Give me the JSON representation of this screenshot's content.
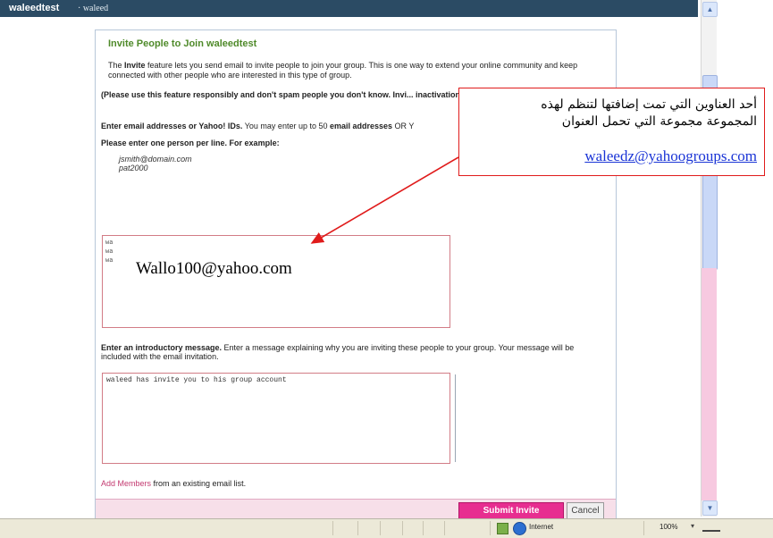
{
  "header": {
    "group_name": "waleedtest",
    "sub": "· waleed"
  },
  "panel": {
    "title": "Invite People to Join waleedtest",
    "intro_prefix": "The ",
    "intro_strong": "Invite",
    "intro_rest": " feature lets you send email to invite people to join your group. This is one way to extend your online community and keep connected with other people who are interested in this type of group.",
    "warning": "(Please use this feature responsibly and don't spam people you don't know. Invi... inactivation of your account.)",
    "enter_strong": "Enter email addresses or Yahoo! IDs.",
    "enter_rest": " You may enter up to 50 ",
    "enter_strong2": "email addresses",
    "enter_tail": " OR Y",
    "per_line": "Please enter one person per line. For example:",
    "example_1": "jsmith@domain.com",
    "example_2": "pat2000",
    "email_lines": [
      "wa",
      "wa",
      "wa"
    ],
    "email_big": "Wallo100@yahoo.com",
    "intro_msg_strong": "Enter an introductory message.",
    "intro_msg_rest": " Enter a message explaining why you are inviting these people to your group. Your message will be included with the email invitation.",
    "message_text": "waleed has invite you to his group account",
    "add_members_link": "Add Members",
    "add_members_rest": " from an existing email list.",
    "submit_label": "Submit Invite",
    "cancel_label": "Cancel"
  },
  "callout": {
    "line1": "أحد العناوين التي تمت إضافتها لتنظم لهذه",
    "line2": "المجموعة مجموعة التي تحمل العنوان",
    "email": "waleedz@yahoogroups.com"
  },
  "statusbar": {
    "zone": "Internet",
    "zoom": "100%"
  },
  "icons": {
    "scroll_up": "scroll-up-icon",
    "scroll_down": "scroll-down-icon",
    "zone": "globe-icon",
    "security": "protected-mode-icon",
    "zoom": "zoom-icon"
  },
  "colors": {
    "header_bg": "#2b4b64",
    "title_green": "#4f8a2a",
    "submit_pink": "#e72e90",
    "callout_red": "#e01b1b",
    "link_blue": "#1a34d6"
  }
}
